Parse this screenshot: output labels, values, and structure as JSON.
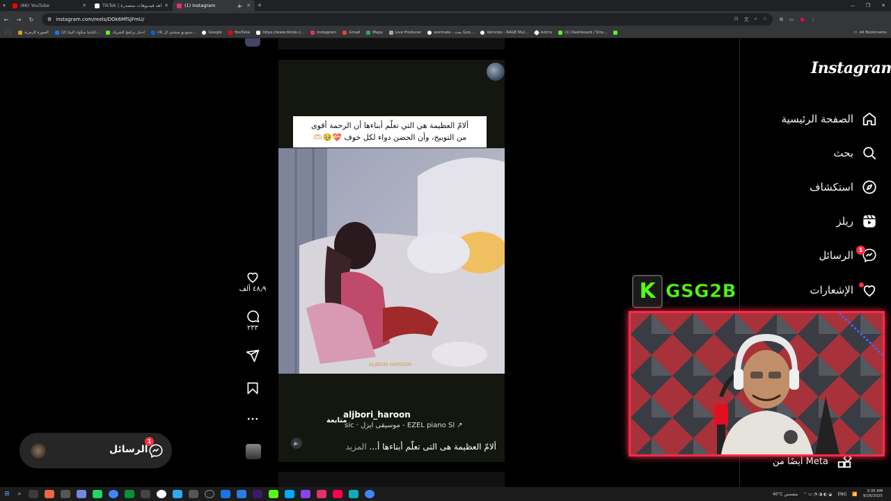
{
  "browser": {
    "tabs": [
      {
        "label": "(86) YouTube",
        "color": "#ff0000"
      },
      {
        "label": "TikTok | شاهد فيديوهات متصدرة",
        "color": "#ffffff"
      },
      {
        "label": "(1) Instagram",
        "color": "#e1306c",
        "active": true
      }
    ],
    "url": "instagram.com/reels/DOk6MfSjFmU/",
    "bookmarks": [
      {
        "label": "الصورة الرمزية",
        "color": "#d4a017"
      },
      {
        "label": "(2) الباشا سكواد البيتا...",
        "color": "#1877f2"
      },
      {
        "label": "ادخل برنامج الشريك",
        "color": "#53fc18"
      },
      {
        "label": "(4) ستوديو منشئي ال...",
        "color": "#0064e0"
      },
      {
        "label": "Google",
        "color": "#ffffff"
      },
      {
        "label": "YouTube",
        "color": "#ff0000"
      },
      {
        "label": "https://www.tiktok.c...",
        "color": "#ffffff"
      },
      {
        "label": "Instagram",
        "color": "#e1306c"
      },
      {
        "label": "Gmail",
        "color": "#ea4335"
      },
      {
        "label": "Maps",
        "color": "#34a853"
      },
      {
        "label": "Live Producer",
        "color": "#aaaaaa"
      },
      {
        "label": "wormate - بحث Goo...",
        "color": "#ffffff"
      },
      {
        "label": "Vehicles - RAGE Mul...",
        "color": "#ffffff"
      },
      {
        "label": "botrix",
        "color": "#ffffff"
      },
      {
        "label": "(1) Dashboard / Stre...",
        "color": "#53fc18"
      }
    ],
    "all_bookmarks": "All Bookmarks"
  },
  "reel": {
    "caption_line1": "ألامّ العظيمة هي التي تعلّم أبناءها أن الرحمة أقوى",
    "caption_line2": "من التوبيخ، وأن الحضن دواء لكل خوف 💝🥹🫶🏻",
    "username": "aljbori_haroon",
    "follow": "متابعة",
    "audio": "sic · موسيقى ايزل - EZEL piano  Sl ↗",
    "description": "ألامّ العظيمة هى التى تعلّم أبناءها أ...",
    "more": "المزيد",
    "watermark": "ALJBORI HAROON"
  },
  "actions": {
    "likes": "٤٨٫٩ ألف",
    "comments": "٢٣٣"
  },
  "messages_pill": {
    "label": "الرسائل",
    "badge": "1"
  },
  "sidebar": {
    "logo": "Instagram",
    "items": [
      {
        "label": "الصفحة الرئيسية",
        "icon": "home-icon"
      },
      {
        "label": "بحث",
        "icon": "search-icon"
      },
      {
        "label": "استكشاف",
        "icon": "explore-icon"
      },
      {
        "label": "ريلز",
        "icon": "reels-icon"
      },
      {
        "label": "الرسائل",
        "icon": "messenger-icon",
        "badge": "1"
      },
      {
        "label": "الإشعارات",
        "icon": "heart-icon"
      }
    ],
    "meta": "أيضًا من Meta"
  },
  "overlay": {
    "kick_letter": "K",
    "channel": "GSG2B",
    "accent": "#53fc18",
    "frame_color": "#ff2a4a"
  },
  "taskbar": {
    "weather": "40°C  مشمس",
    "lang": "ENG",
    "time": "3:35 AM",
    "date": "9/16/2025"
  }
}
